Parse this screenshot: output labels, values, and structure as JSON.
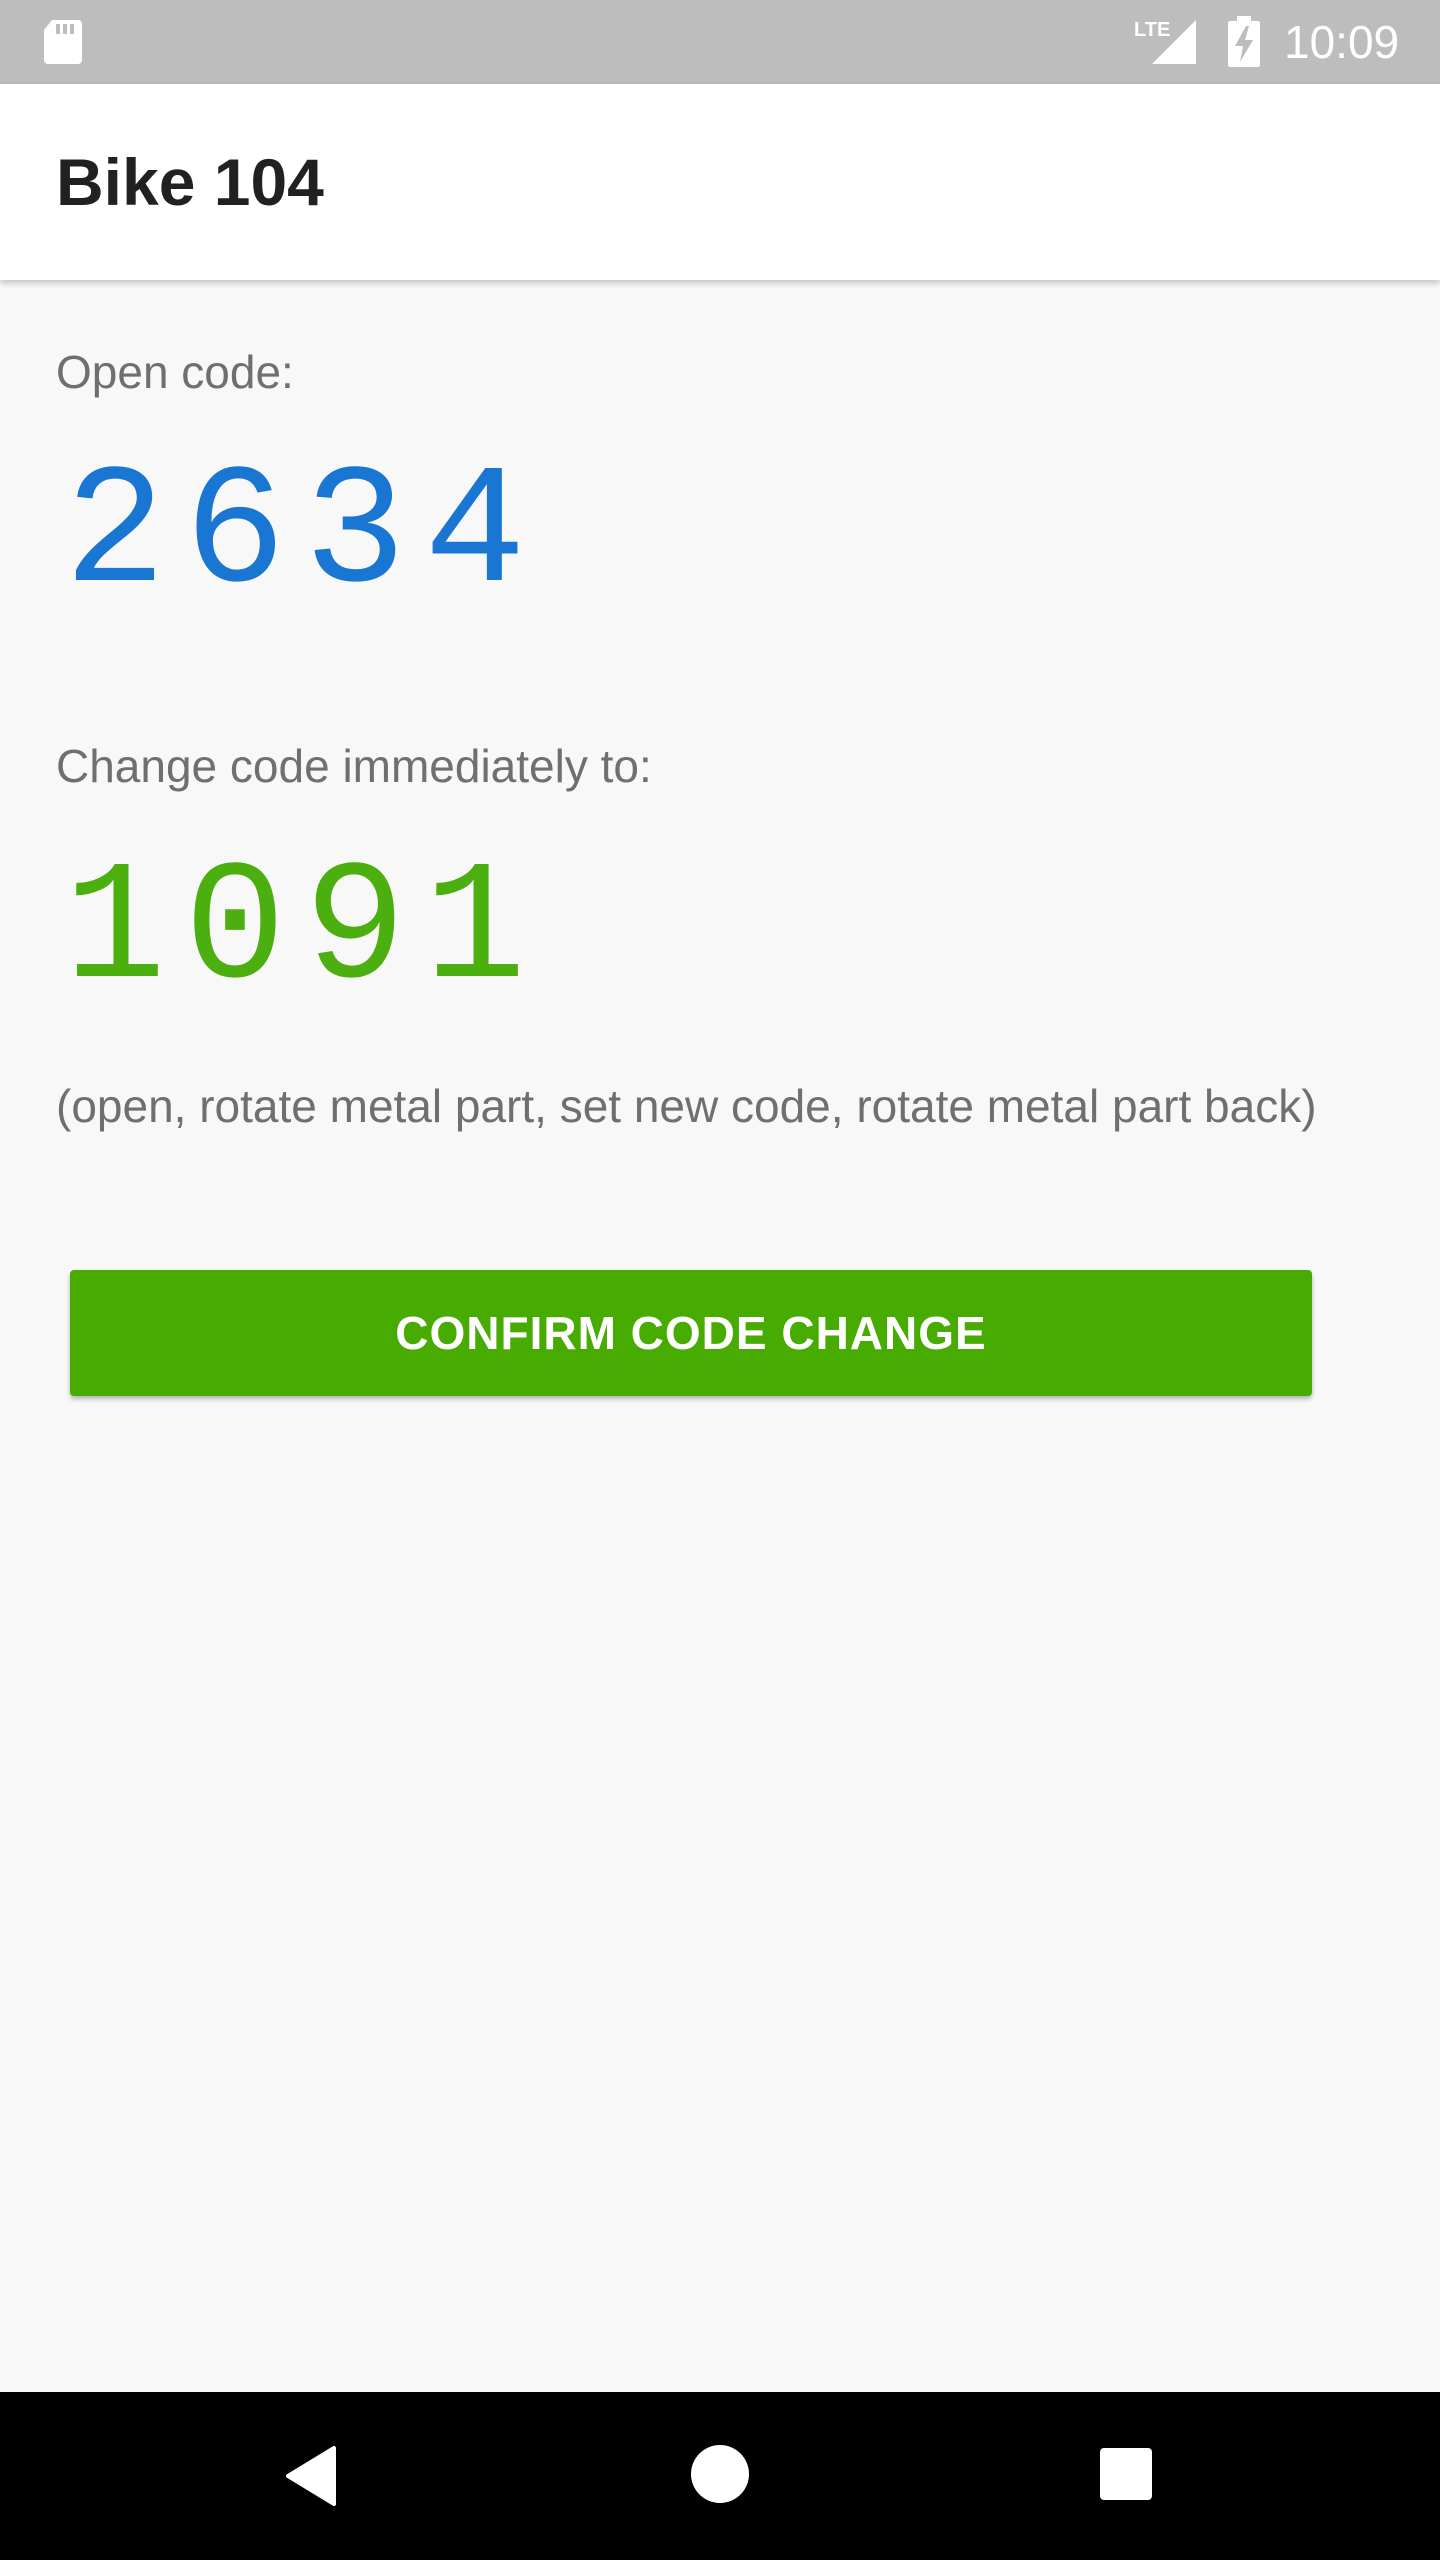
{
  "status_bar": {
    "time": "10:09",
    "icons": [
      "sd-card-icon",
      "lte-signal-icon",
      "battery-charging-icon"
    ],
    "lte_label": "LTE"
  },
  "app_bar": {
    "title": "Bike 104"
  },
  "content": {
    "open_code_label": "Open code:",
    "open_code": "2634",
    "change_code_label": "Change code immediately to:",
    "new_code": "1091",
    "instructions": "(open, rotate metal part, set new code, rotate metal part back)",
    "confirm_button_label": "CONFIRM CODE CHANGE"
  },
  "nav_bar": {
    "icons": [
      "back-icon",
      "home-icon",
      "recents-icon"
    ]
  },
  "colors": {
    "open_code": "#1976d2",
    "new_code": "#4caf10",
    "button": "#47ab02",
    "status_bar": "#bdbdbd"
  }
}
